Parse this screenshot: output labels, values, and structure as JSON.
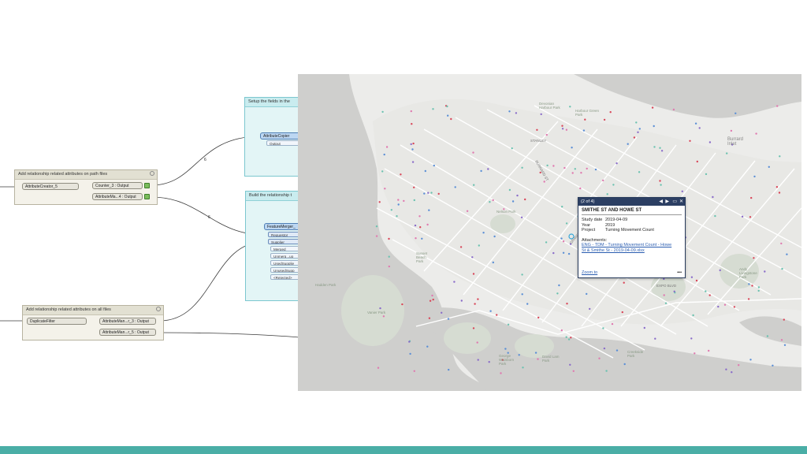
{
  "workbench": {
    "bookmark_setup": {
      "title": "Setup the fields in the"
    },
    "bookmark_build": {
      "title": "Build the relationship t"
    },
    "bookmark_path": {
      "title": "Add relationship related attributes on path files"
    },
    "bookmark_all": {
      "title": "Add relationship related attributes on all files"
    },
    "attribute_copier": {
      "label": "AttributeCopier",
      "port_output": "Output"
    },
    "feature_merger": {
      "label": "FeatureMerger_",
      "ports": [
        "Requestor",
        "Supplier",
        "Merged",
        "Unmerg...uo",
        "UsedSupplie",
        "UnusedSupp",
        "<Rejected>"
      ]
    },
    "attribute_creator": {
      "label": "AttributeCreator_5"
    },
    "counter_output": {
      "label": "Counter_3 : Output"
    },
    "attribute_manager_4": {
      "label": "AttributeMa...4 : Output"
    },
    "duplicate_filter": {
      "label": "DuplicateFilter"
    },
    "attribute_manager_3": {
      "label": "AttributeMan...r_3 : Output"
    },
    "attribute_manager_5": {
      "label": "AttributeMan...r_5 : Output"
    },
    "connection_counts": {
      "top": "6",
      "middle": "6"
    }
  },
  "map": {
    "labels": {
      "burrard_inlet": "Burrard Inlet",
      "stanley": "STANLEY",
      "expo_blvd": "EXPO BLVD",
      "harbour_green_park": "Harbour Green Park",
      "devonian_harbour_park": "Devonian Harbour Park",
      "nelson_park": "Nelson Park",
      "sunset_beach": "Sunset Beach Park",
      "vanier_park": "Vanier Park",
      "hadden_park": "Hadden Park",
      "george_wainborn_park": "George Wainborn Park",
      "david_lam_park": "David Lam Park",
      "creekside_park": "Creekside Park",
      "andy_livingstone_park": "Andy Livingstone Park",
      "burrard": "BURRARD ST",
      "granville": "GRANVILLE ST"
    },
    "popup": {
      "counter": "(2 of 4)",
      "title": "SMITHE ST AND HOWE ST",
      "fields": [
        {
          "key": "Study date",
          "value": "2019-04-09"
        },
        {
          "key": "Year",
          "value": "2019"
        },
        {
          "key": "Project",
          "value": "Turning Movement Count"
        }
      ],
      "attachments_label": "Attachments:",
      "attachment_link_1": "ENG - TDM - Turning Movement Count - Howe",
      "attachment_link_2": "St & Smithe St - 2019-04-09.xlsx",
      "zoom_label": "Zoom to",
      "more_label": "•••"
    }
  },
  "colors": {
    "accent_bar": "#4aaea6",
    "popup_header": "#2c3f63"
  }
}
